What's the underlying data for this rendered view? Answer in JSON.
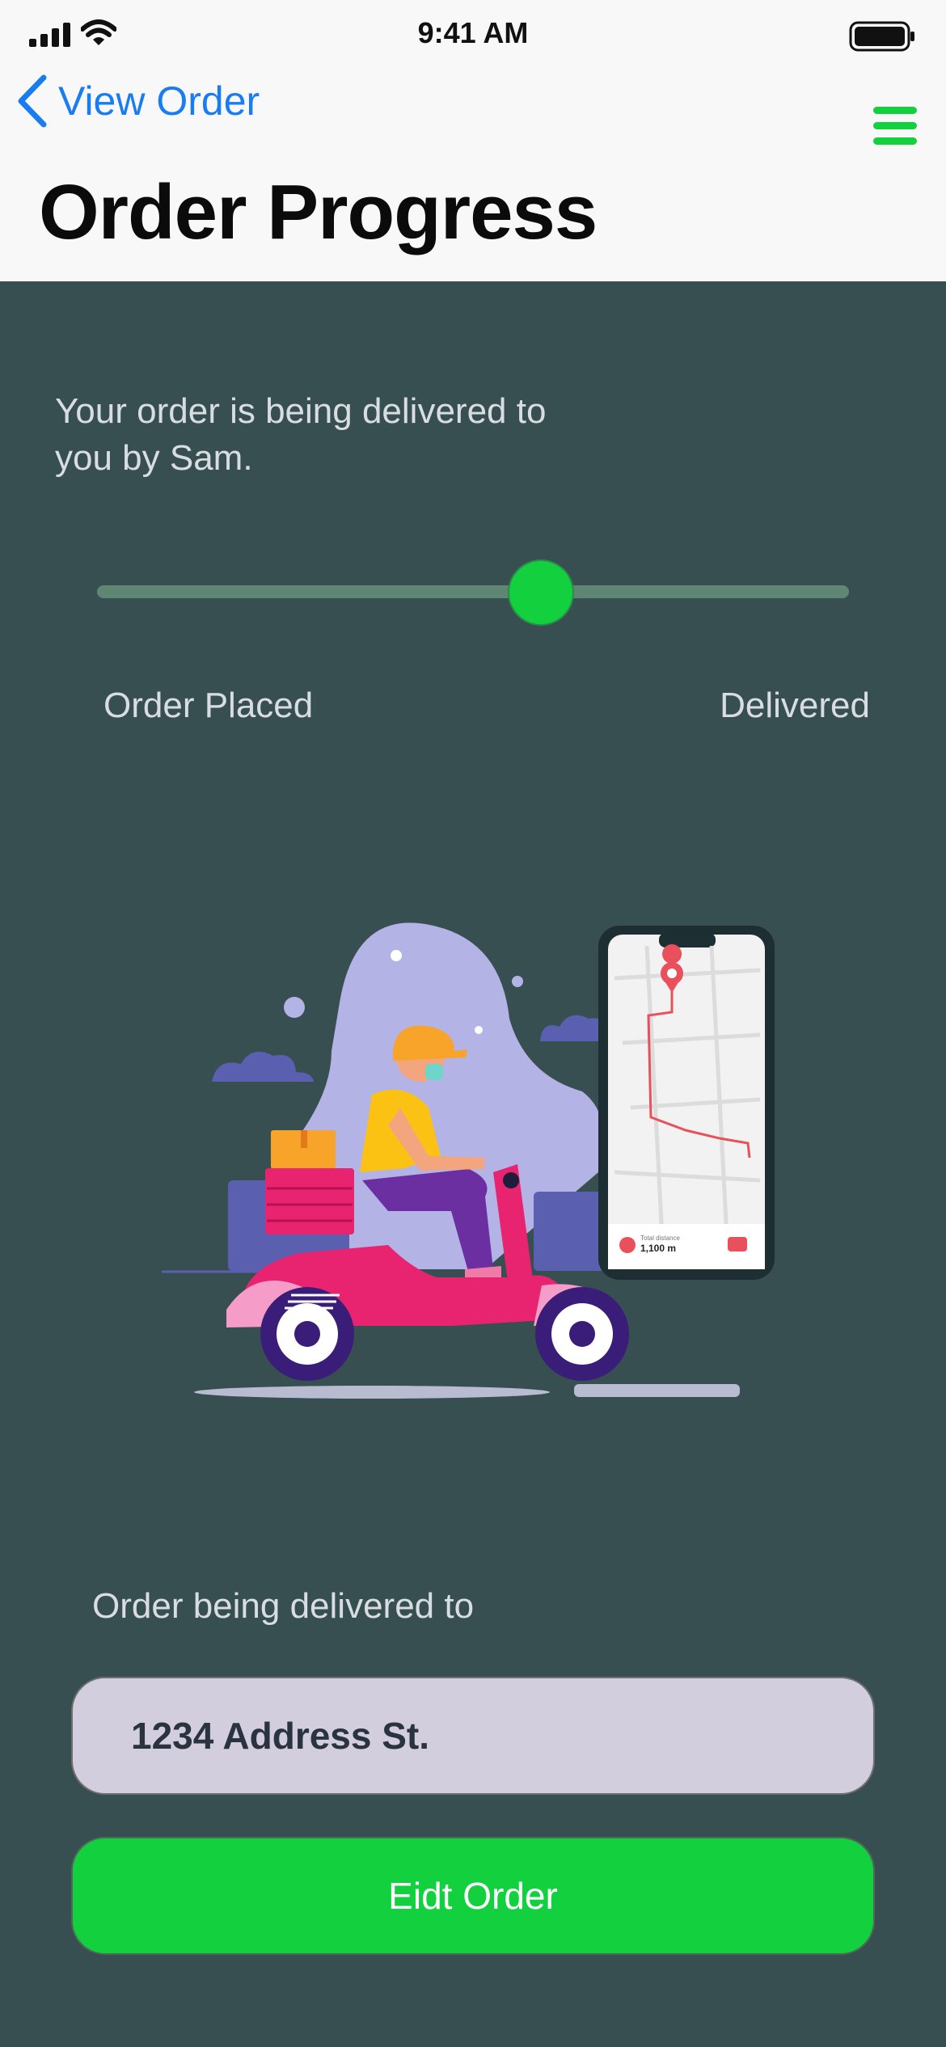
{
  "status_bar": {
    "time": "9:41 AM"
  },
  "nav": {
    "back_label": "View Order"
  },
  "page": {
    "title": "Order Progress"
  },
  "progress": {
    "message": "Your order is being delivered to you by Sam.",
    "start_label": "Order Placed",
    "end_label": "Delivered",
    "value": 0.59
  },
  "map_card": {
    "distance_caption": "Total distance",
    "distance_value": "1,100 m"
  },
  "delivery": {
    "caption": "Order being delivered to",
    "address": "1234 Address St."
  },
  "actions": {
    "edit_label": "Eidt Order"
  },
  "colors": {
    "accent_green": "#13d13e",
    "link_blue": "#1a7cf1",
    "background": "#384f52"
  }
}
